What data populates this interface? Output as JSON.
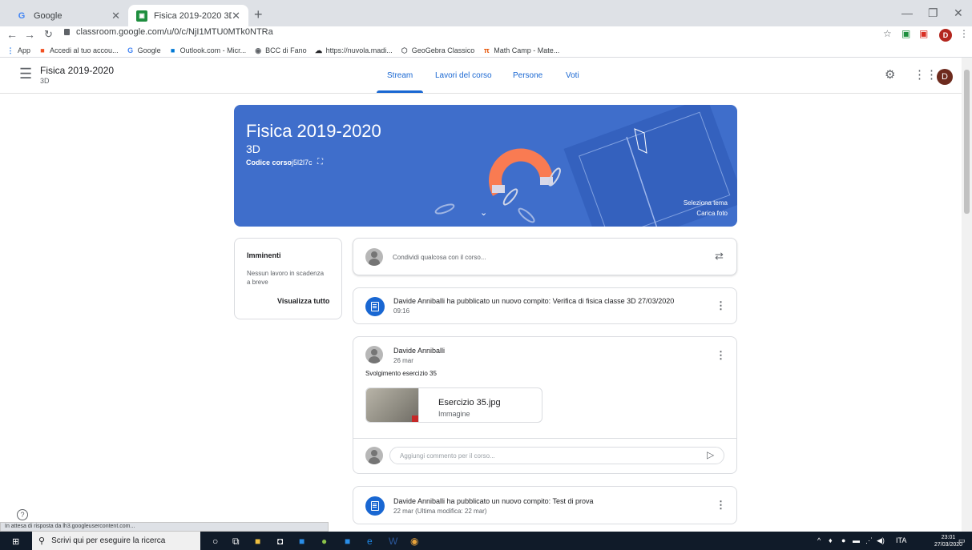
{
  "browser": {
    "tabs": [
      {
        "label": "Google",
        "icon": "google-favicon"
      },
      {
        "label": "Fisica 2019-2020 3D",
        "icon": "classroom-favicon"
      }
    ],
    "url": "classroom.google.com/u/0/c/NjI1MTU0MTk0NTRa",
    "profile_initial": "D",
    "bookmarks": [
      {
        "label": "App",
        "icon": "apps-grid-icon"
      },
      {
        "label": "Accedi al tuo accou...",
        "icon": "microsoft-icon"
      },
      {
        "label": "Google",
        "icon": "google-icon"
      },
      {
        "label": "Outlook.com - Micr...",
        "icon": "outlook-icon"
      },
      {
        "label": "BCC di Fano",
        "icon": "globe-icon"
      },
      {
        "label": "https://nuvola.madi...",
        "icon": "cloud-icon"
      },
      {
        "label": "GeoGebra Classico",
        "icon": "geogebra-icon"
      },
      {
        "label": "Math Camp - Mate...",
        "icon": "mathcamp-icon"
      }
    ],
    "status": "In attesa di risposta da lh3.googleusercontent.com..."
  },
  "header": {
    "title": "Fisica 2019-2020",
    "subtitle": "3D",
    "tabs": [
      "Stream",
      "Lavori del corso",
      "Persone",
      "Voti"
    ],
    "active_tab": "Stream",
    "avatar_initial": "D"
  },
  "banner": {
    "title": "Fisica 2019-2020",
    "section": "3D",
    "code_label": "Codice corso",
    "code": "j5l2l7c",
    "select_theme": "Seleziona tema",
    "upload_photo": "Carica foto",
    "color": "#3f6ecb"
  },
  "upcoming": {
    "title": "Imminenti",
    "text": "Nessun lavoro in scadenza a breve",
    "link": "Visualizza tutto"
  },
  "stream": {
    "share_placeholder": "Condividi qualcosa con il corso...",
    "posts": [
      {
        "type": "assignment",
        "title": "Davide Anniballi ha pubblicato un nuovo compito: Verifica di fisica classe 3D 27/03/2020",
        "meta": "09:16"
      },
      {
        "type": "announcement",
        "author": "Davide Anniballi",
        "date": "26 mar",
        "text": "Svolgimento esercizio 35",
        "attachment": {
          "name": "Esercizio 35.jpg",
          "type": "Immagine"
        },
        "comment_placeholder": "Aggiungi commento per il corso..."
      },
      {
        "type": "assignment",
        "title": "Davide Anniballi ha pubblicato un nuovo compito: Test di prova",
        "meta": "22 mar (Ultima modifica: 22 mar)"
      }
    ]
  },
  "taskbar": {
    "search_placeholder": "Scrivi qui per eseguire la ricerca",
    "lang": "ITA",
    "time": "23:01",
    "date": "27/03/2020"
  },
  "colors": {
    "accent": "#1967d2",
    "taskbar": "#101b29"
  }
}
